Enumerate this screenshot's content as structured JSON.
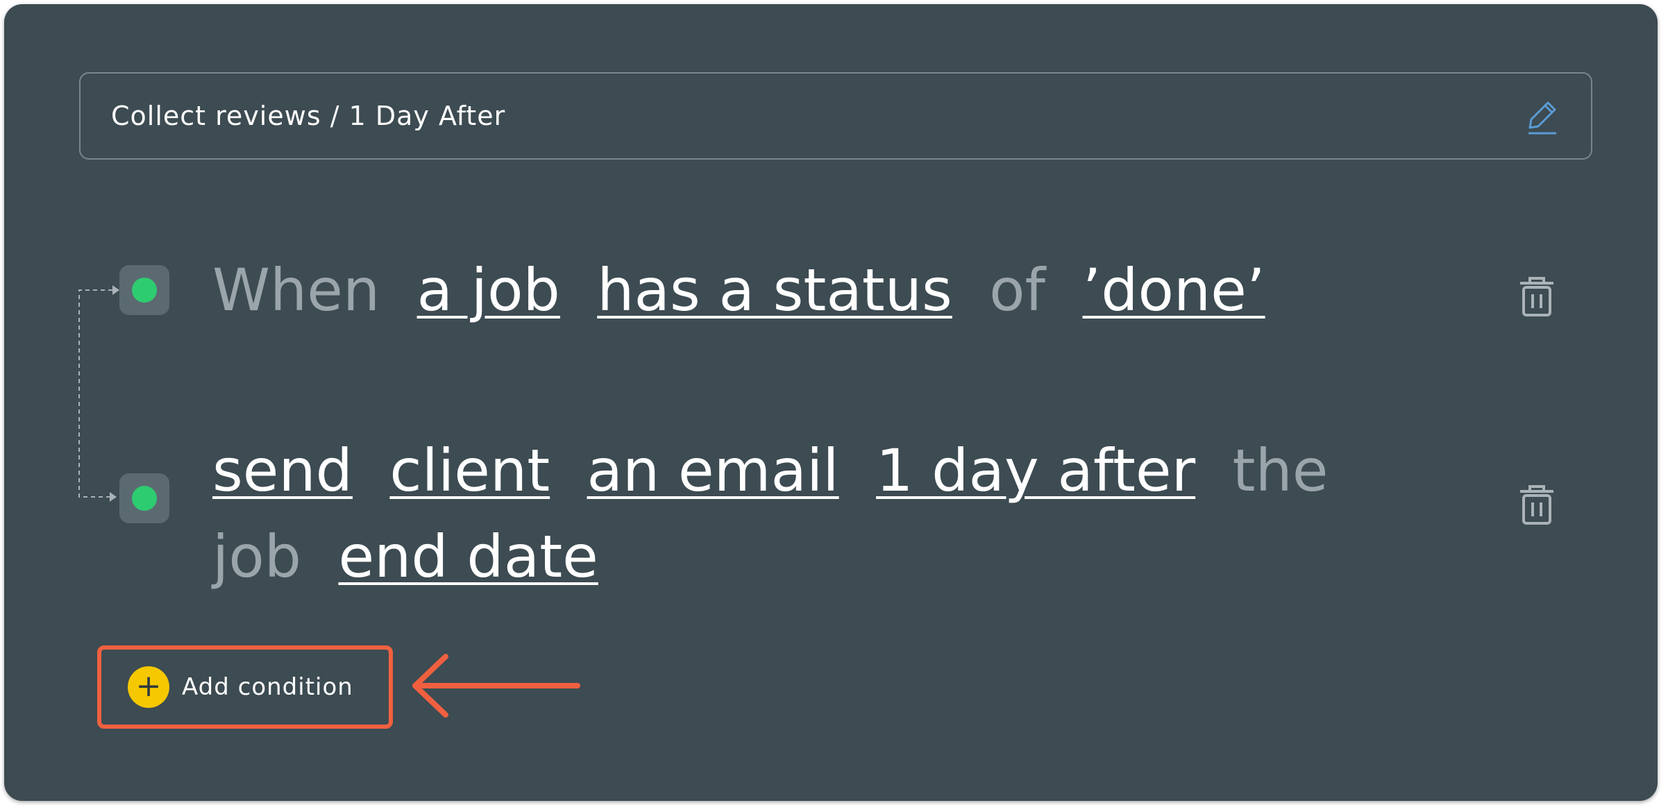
{
  "header": {
    "title": "Collect reviews / 1 Day After",
    "edit_icon": "pencil-icon"
  },
  "rules": [
    {
      "status_color": "#2ecc71",
      "parts": [
        {
          "text": "When",
          "kind": "static"
        },
        {
          "text": "a job",
          "kind": "token"
        },
        {
          "text": "has a status",
          "kind": "token"
        },
        {
          "text": "of",
          "kind": "static"
        },
        {
          "text": "’done’",
          "kind": "token"
        }
      ],
      "delete_icon": "trash-icon"
    },
    {
      "status_color": "#2ecc71",
      "parts": [
        {
          "text": "send",
          "kind": "token"
        },
        {
          "text": "client",
          "kind": "token"
        },
        {
          "text": "an email",
          "kind": "token"
        },
        {
          "text": "1 day after",
          "kind": "token"
        },
        {
          "text": "the job",
          "kind": "static"
        },
        {
          "text": "end date",
          "kind": "token"
        }
      ],
      "delete_icon": "trash-icon"
    }
  ],
  "add_condition": {
    "label": "Add condition",
    "icon": "plus-icon",
    "plus_symbol": "+"
  },
  "colors": {
    "panel": "#3d4b52",
    "accent_green": "#2ecc71",
    "add_button": "#f5c800",
    "highlight": "#f06040",
    "edit_icon": "#5b9bd5"
  }
}
